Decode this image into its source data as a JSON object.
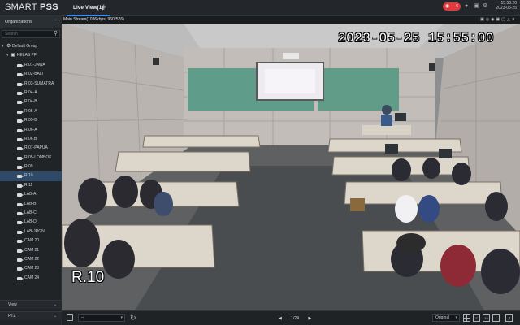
{
  "app": {
    "logo_light": "SMART ",
    "logo_bold": "PSS",
    "tab_label": "Live View(1)",
    "alarm_count": "6",
    "clock_time": "15:56:20",
    "clock_date": "2023-05-25"
  },
  "sidebar": {
    "organizations_label": "Organizations",
    "search_placeholder": "Search",
    "root_label": "Default Group",
    "group_label": "KELAS PF",
    "devices": [
      "R.01-JAWA",
      "R.02-BALI",
      "R.03-SUMATRA",
      "R.04-A",
      "R.04-B",
      "R.05-A",
      "R.05-B",
      "R.06-A",
      "R.06.B",
      "R.07-PAPUA",
      "R.05-LOMBOK",
      "R.09",
      "R.10",
      "R.11",
      "LAB-A",
      "LAB-B",
      "LAB-C",
      "LAB-D",
      "LAB-JRGN",
      "CAM 20",
      "CAM 21",
      "CAM 22",
      "CAM 23",
      "CAM 24"
    ],
    "selected_device": "R.10",
    "view_label": "View",
    "ptz_label": "PTZ"
  },
  "video": {
    "stream_info": "Main Stream(1036kbps, 960*576)",
    "osd_timestamp": "2023-05-25 15:55:00",
    "osd_channel": "R.10"
  },
  "toolbar": {
    "view_select_value": "--",
    "pager_text": "1/24",
    "aspect_ratio_value": "Original",
    "layout_16_label": "16"
  },
  "colors": {
    "accent": "#3c8df0",
    "alarm": "#e4393c",
    "selected_row": "#2e4a68",
    "background": "#1e2124"
  }
}
